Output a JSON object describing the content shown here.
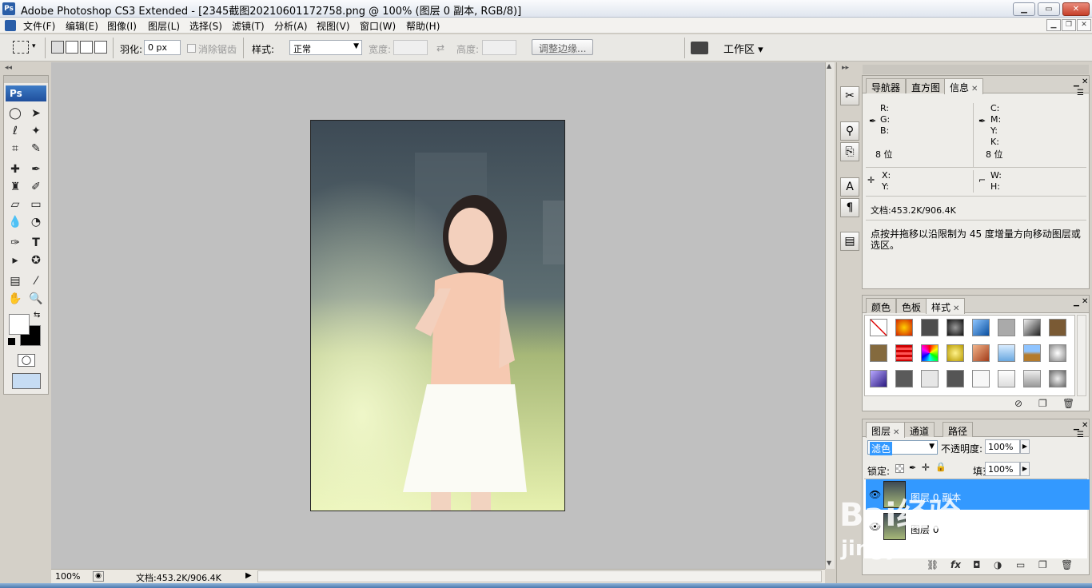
{
  "window": {
    "app_icon": "Ps",
    "title": "Adobe Photoshop CS3 Extended - [2345截图20210601172758.png @ 100% (图层 0 副本, RGB/8)]",
    "buttons": [
      "▁",
      "▭",
      "✕"
    ]
  },
  "menu": {
    "items": [
      "文件(F)",
      "编辑(E)",
      "图像(I)",
      "图层(L)",
      "选择(S)",
      "滤镜(T)",
      "分析(A)",
      "视图(V)",
      "窗口(W)",
      "帮助(H)"
    ],
    "doc_buttons": [
      "▁",
      "❐",
      "✕"
    ]
  },
  "options": {
    "feather_label": "羽化:",
    "feather_value": "0 px",
    "antialias_label": "消除锯齿",
    "style_label": "样式:",
    "style_value": "正常",
    "width_label": "宽度:",
    "height_label": "高度:",
    "refine_button": "调整边缘...",
    "workspace_label": "工作区 ▾"
  },
  "toolbox": {
    "header": "Ps"
  },
  "status": {
    "zoom": "100%",
    "doc_size": "文档:453.2K/906.4K"
  },
  "info_panel": {
    "tabs": [
      "导航器",
      "直方图",
      "信息"
    ],
    "rgb": [
      "R:",
      "G:",
      "B:"
    ],
    "cmyk": [
      "C:",
      "M:",
      "Y:",
      "K:"
    ],
    "bits_left": "8 位",
    "bits_right": "8 位",
    "xy": [
      "X:",
      "Y:"
    ],
    "wh": [
      "W:",
      "H:"
    ],
    "doc_info": "文档:453.2K/906.4K",
    "hint_line1": "点按并拖移以沿限制为 45 度增量方向移动图层或",
    "hint_line2": "选区。"
  },
  "styles_panel": {
    "tabs": [
      "颜色",
      "色板",
      "样式"
    ]
  },
  "layers_panel": {
    "tabs": [
      "图层",
      "通道",
      "路径"
    ],
    "blend_mode": "滤色",
    "opacity_label": "不透明度:",
    "opacity_value": "100%",
    "lock_label": "锁定:",
    "fill_label": "填充:",
    "fill_value": "100%",
    "layers": [
      {
        "name": "图层 0 副本",
        "selected": true
      },
      {
        "name": "图层 0",
        "selected": false
      }
    ]
  },
  "watermark": {
    "brand": "Bai经验",
    "url": "jingyan.baidu.com"
  },
  "colors": {
    "accent": "#3399ff",
    "workspace": "#c0c0c0"
  }
}
